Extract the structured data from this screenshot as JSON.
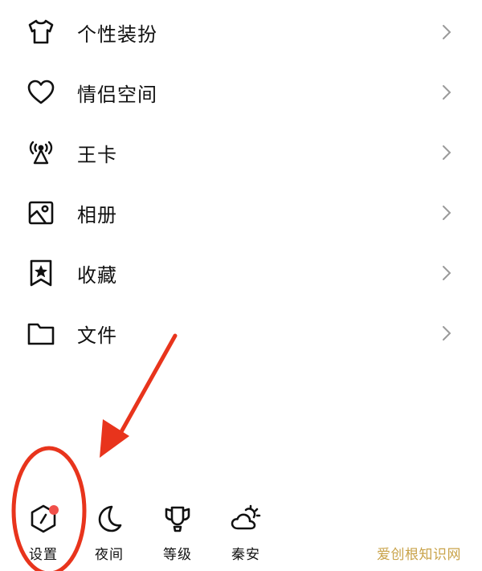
{
  "menu": {
    "items": [
      {
        "label": "个性装扮",
        "icon": "tshirt-icon"
      },
      {
        "label": "情侣空间",
        "icon": "heart-icon"
      },
      {
        "label": "王卡",
        "icon": "antenna-icon"
      },
      {
        "label": "相册",
        "icon": "photo-album-icon"
      },
      {
        "label": "收藏",
        "icon": "bookmark-star-icon"
      },
      {
        "label": "文件",
        "icon": "folder-icon"
      }
    ]
  },
  "bottom_bar": {
    "items": [
      {
        "label": "设置",
        "icon": "settings-hexagon-icon",
        "badge": true
      },
      {
        "label": "夜间",
        "icon": "moon-icon"
      },
      {
        "label": "等级",
        "icon": "level-crown-icon"
      },
      {
        "label": "秦安",
        "icon": "weather-cloud-sun-icon"
      }
    ]
  },
  "annotation": {
    "color": "#e8341c"
  },
  "watermark": "爱创根知识网"
}
